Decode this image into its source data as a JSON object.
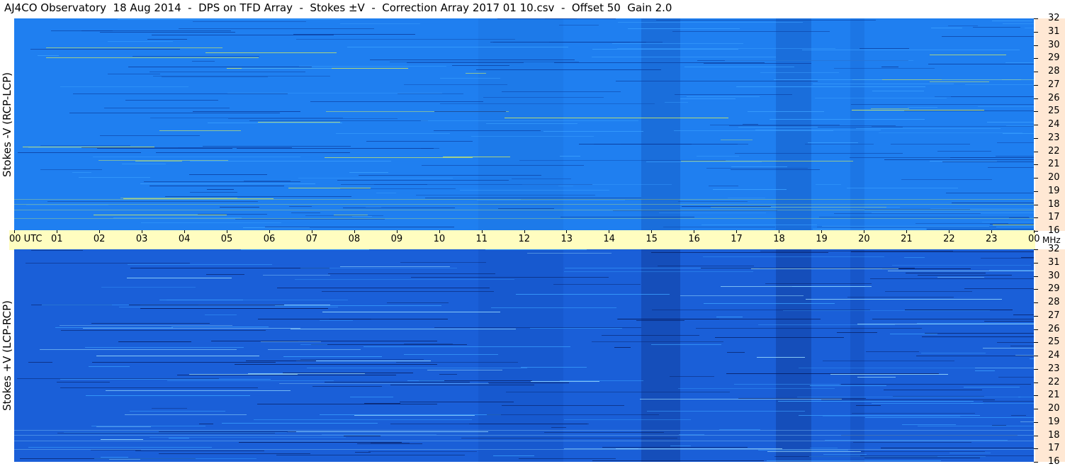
{
  "title": "AJ4CO Observatory  18 Aug 2014  -  DPS on TFD Array  -  Stokes ±V  -  Correction Array 2017 01 10.csv  -  Offset 50  Gain 2.0",
  "colors": {
    "top_base": "#1f7ff0",
    "bottom_base": "#1a5fd8",
    "axis_band": "#fffdc0",
    "right_strip": "#ffe8d4"
  },
  "chart_data": [
    {
      "type": "heatmap",
      "panel": "top",
      "ylabel": "Stokes -V (RCP-LCP)",
      "x_ticks": [
        "00 UTC",
        "01",
        "02",
        "03",
        "04",
        "05",
        "06",
        "07",
        "08",
        "09",
        "10",
        "11",
        "12",
        "13",
        "14",
        "15",
        "16",
        "17",
        "18",
        "19",
        "20",
        "21",
        "22",
        "23",
        "00"
      ],
      "x_unit": "",
      "y_ticks": [
        "32",
        "31",
        "30",
        "29",
        "28",
        "27",
        "26",
        "25",
        "24",
        "23",
        "22",
        "21",
        "20",
        "19",
        "18",
        "17",
        "16"
      ],
      "ylim": [
        16,
        32
      ],
      "xlim": [
        0,
        24
      ]
    },
    {
      "type": "heatmap",
      "panel": "bottom",
      "ylabel": "Stokes +V (LCP-RCP)",
      "x_ticks": [
        "00 UTC",
        "01",
        "02",
        "03",
        "04",
        "05",
        "06",
        "07",
        "08",
        "09",
        "10",
        "11",
        "12",
        "13",
        "14",
        "15",
        "16",
        "17",
        "18",
        "19",
        "20",
        "21",
        "22",
        "23",
        "00"
      ],
      "x_unit": "MHz",
      "y_ticks": [
        "32",
        "31",
        "30",
        "29",
        "28",
        "27",
        "26",
        "25",
        "24",
        "23",
        "22",
        "21",
        "20",
        "19",
        "18",
        "17",
        "16"
      ],
      "ylim": [
        16,
        32
      ],
      "xlim": [
        0,
        24
      ]
    }
  ]
}
